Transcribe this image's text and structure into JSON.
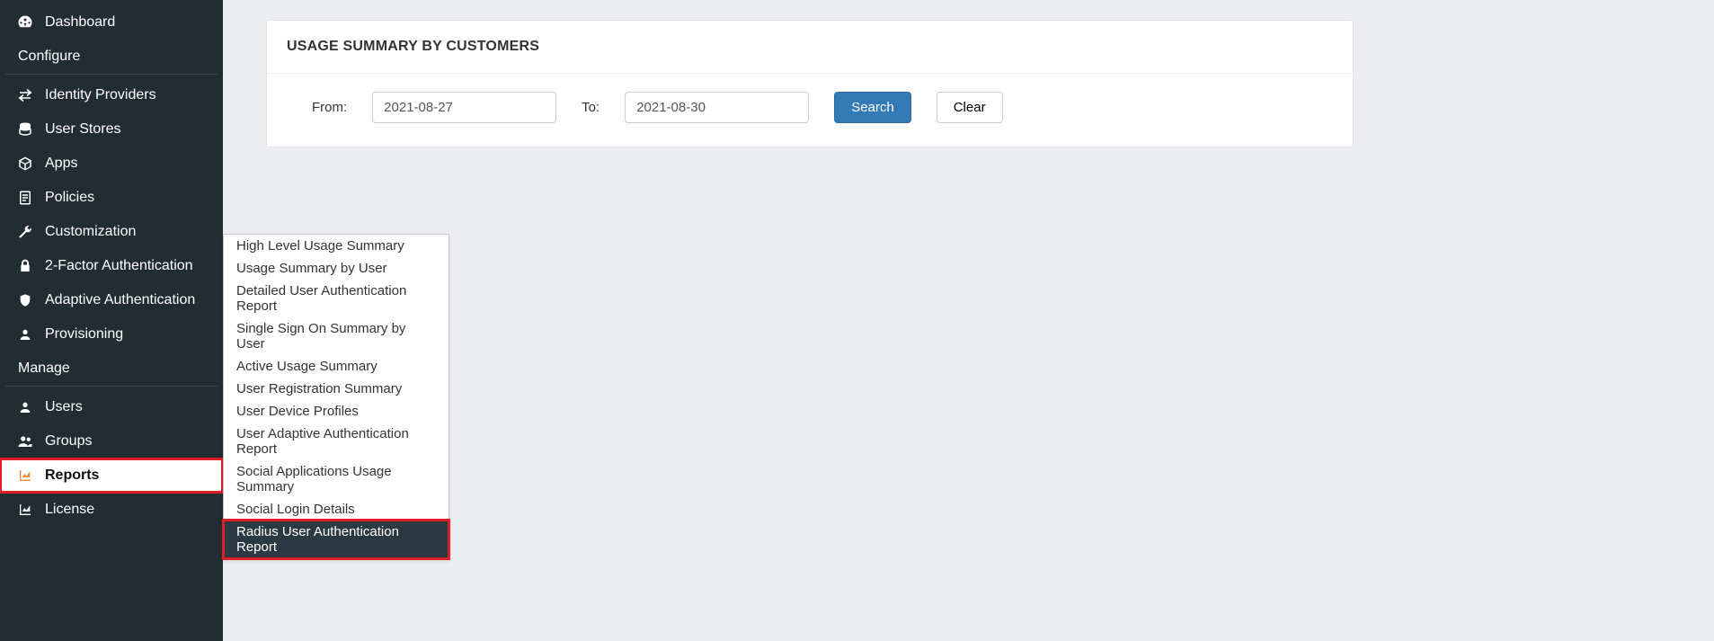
{
  "sidebar": {
    "items": [
      {
        "label": "Dashboard",
        "icon": "gauge-icon"
      },
      {
        "section": "Configure"
      },
      {
        "label": "Identity Providers",
        "icon": "exchange-icon"
      },
      {
        "label": "User Stores",
        "icon": "database-icon"
      },
      {
        "label": "Apps",
        "icon": "cube-icon"
      },
      {
        "label": "Policies",
        "icon": "document-icon"
      },
      {
        "label": "Customization",
        "icon": "wrench-icon"
      },
      {
        "label": "2-Factor Authentication",
        "icon": "lock-icon"
      },
      {
        "label": "Adaptive Authentication",
        "icon": "shield-icon"
      },
      {
        "label": "Provisioning",
        "icon": "user-icon"
      },
      {
        "section": "Manage"
      },
      {
        "label": "Users",
        "icon": "user-icon"
      },
      {
        "label": "Groups",
        "icon": "users-icon"
      },
      {
        "label": "Reports",
        "icon": "area-chart-icon",
        "active": true
      },
      {
        "label": "License",
        "icon": "area-chart-icon"
      }
    ]
  },
  "submenu": {
    "items": [
      "High Level Usage Summary",
      "Usage Summary by User",
      "Detailed User Authentication Report",
      "Single Sign On Summary by User",
      "Active Usage Summary",
      "User Registration Summary",
      "User Device Profiles",
      "User Adaptive Authentication Report",
      "Social Applications Usage Summary",
      "Social Login Details",
      "Radius User Authentication Report"
    ],
    "selectedIndex": 10
  },
  "panel": {
    "title": "USAGE SUMMARY BY CUSTOMERS",
    "from_label": "From:",
    "from_value": "2021-08-27",
    "to_label": "To:",
    "to_value": "2021-08-30",
    "search_label": "Search",
    "clear_label": "Clear"
  }
}
